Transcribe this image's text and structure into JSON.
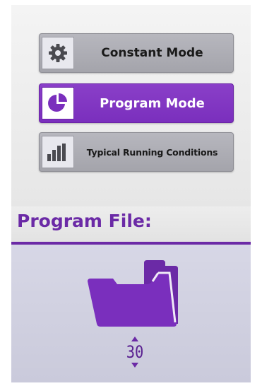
{
  "menu": {
    "constant_mode": {
      "label": "Constant Mode",
      "icon": "gear-icon"
    },
    "program_mode": {
      "label": "Program Mode",
      "icon": "pie-chart-icon",
      "active": true
    },
    "typical_running": {
      "label": "Typical Running Conditions",
      "icon": "bar-chart-icon"
    }
  },
  "program_file": {
    "title": "Program File:",
    "icon": "folder-icon",
    "number": "30"
  },
  "colors": {
    "accent": "#7a2fbd",
    "button_grey": "#aeaeb5",
    "title": "#6b2aa6",
    "panel": "#d1d1e1"
  }
}
